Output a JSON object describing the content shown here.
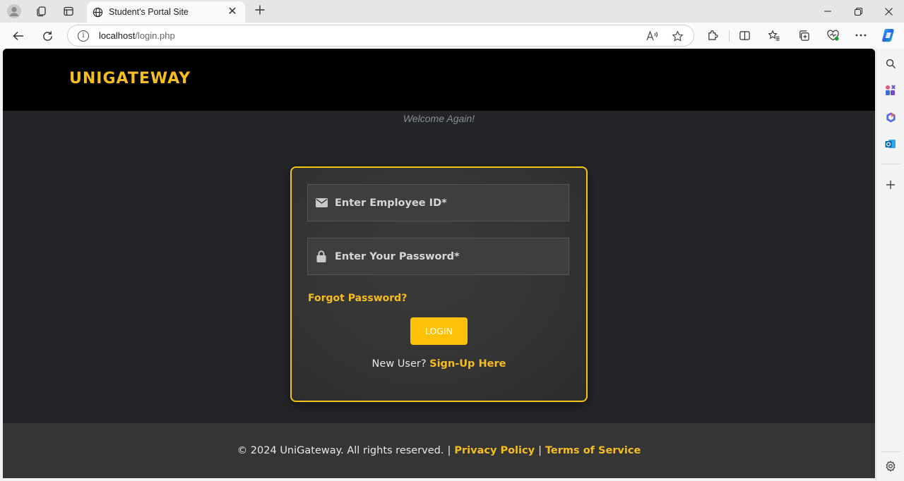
{
  "browser": {
    "tab_title": "Student's Portal Site",
    "url_host": "localhost",
    "url_path": "/login.php",
    "icons": [
      "profile-icon",
      "workspaces-icon",
      "tab-actions-icon",
      "globe-icon",
      "close-icon",
      "plus-icon",
      "minimize-icon",
      "restore-icon",
      "back-icon",
      "refresh-icon",
      "info-icon",
      "read-aloud-icon",
      "favorite-star-icon",
      "extensions-icon",
      "split-screen-icon",
      "favorites-icon",
      "collections-icon",
      "browser-essentials-icon",
      "more-icon",
      "copilot-icon",
      "search-icon",
      "tools-icon",
      "office-icon",
      "outlook-icon",
      "settings-icon"
    ]
  },
  "header": {
    "brand": "UNIGATEWAY"
  },
  "welcome": "Welcome Again!",
  "form": {
    "employee_placeholder": "Enter Employee ID*",
    "password_placeholder": "Enter Your Password*",
    "forgot_label": "Forgot Password?",
    "login_label": "LOGIN",
    "new_user_text": "New User?",
    "signup_label": "Sign-Up Here"
  },
  "footer": {
    "copyright": "© 2024 UniGateway. All rights reserved.",
    "separator": "|",
    "privacy": "Privacy Policy",
    "terms": "Terms of Service"
  },
  "colors": {
    "accent": "#f5bd1f",
    "button": "#ffc107",
    "page_bg": "#232529",
    "header_bg": "#000000",
    "footer_bg": "#353535"
  }
}
